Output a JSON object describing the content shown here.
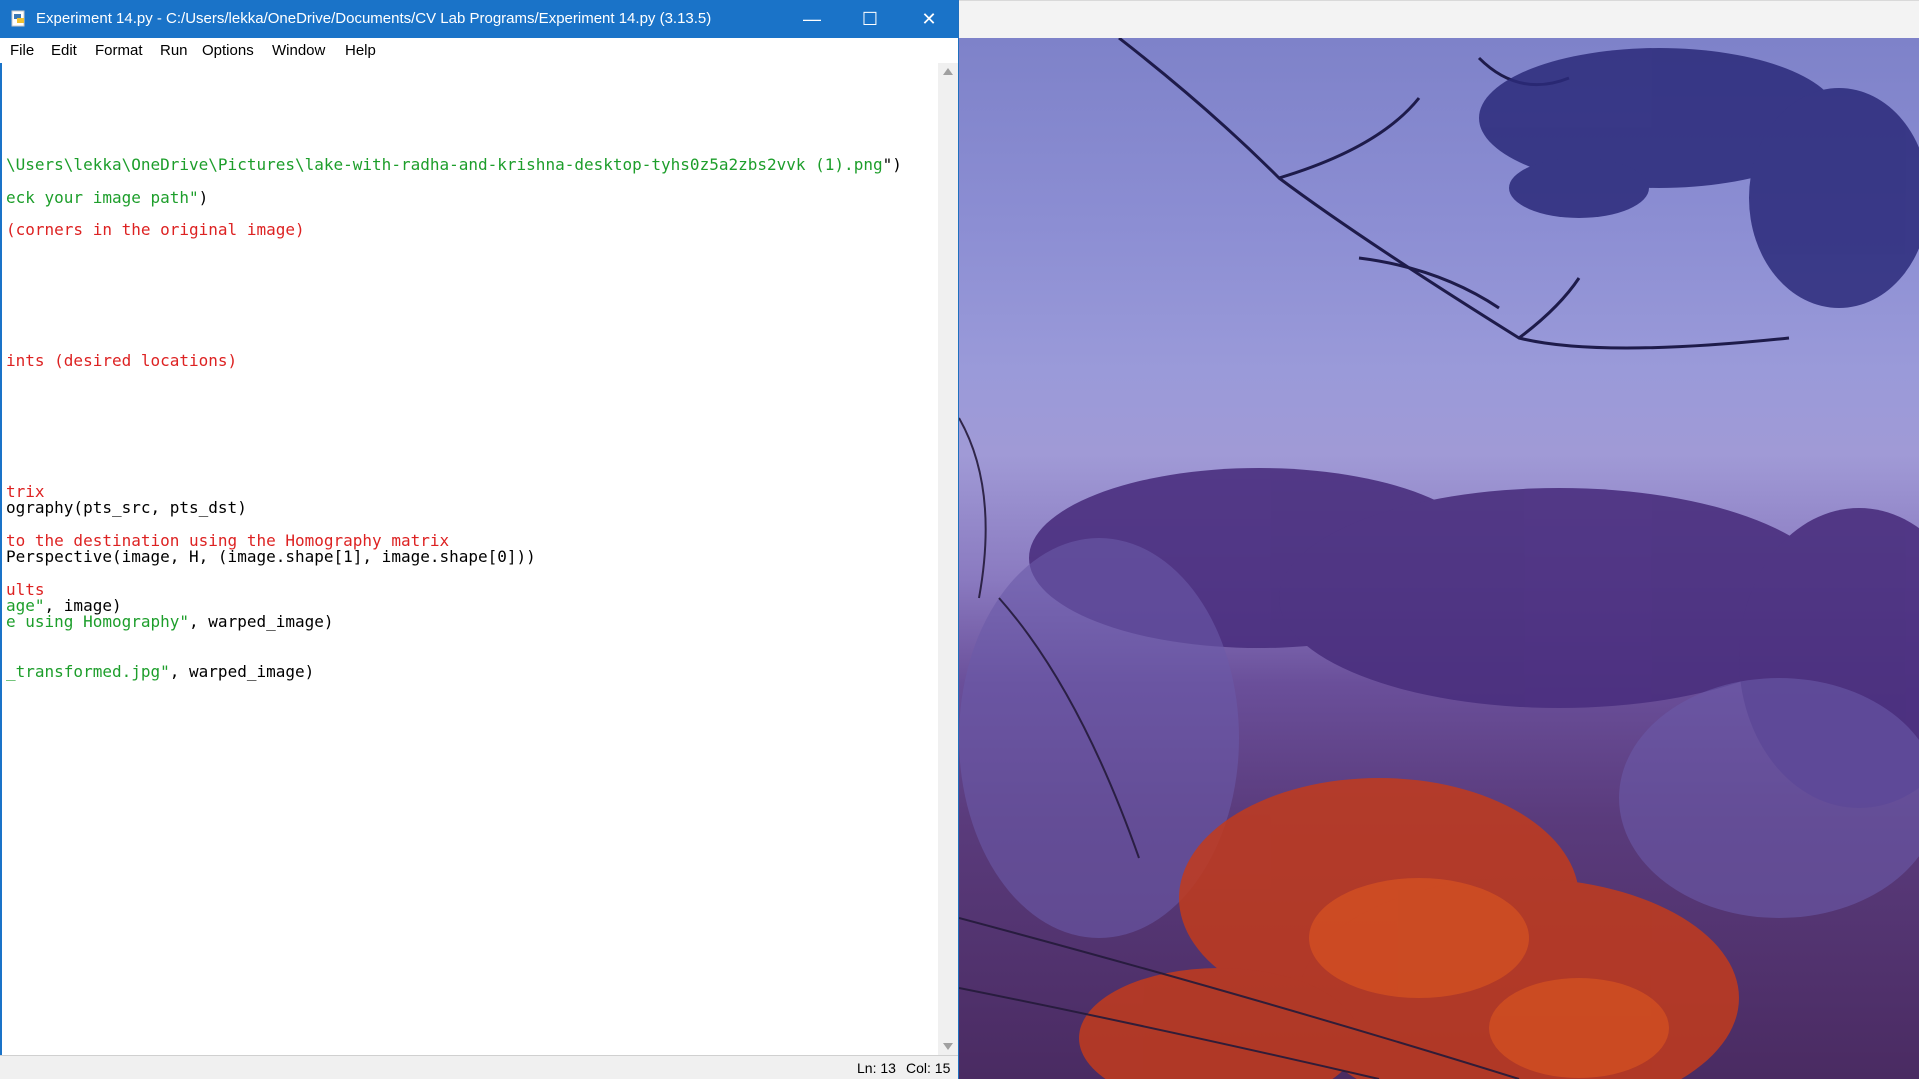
{
  "window": {
    "title": "Experiment 14.py - C:/Users/lekka/OneDrive/Documents/CV Lab Programs/Experiment 14.py (3.13.5)",
    "minimize_glyph": "—",
    "maximize_glyph": "☐",
    "close_glyph": "✕"
  },
  "menu": [
    "File",
    "Edit",
    "Format",
    "Run",
    "Options",
    "Window",
    "Help"
  ],
  "code_lines": [
    {
      "segments": [
        {
          "text": "\\Users\\lekka\\OneDrive\\Pictures\\lake-with-radha-and-krishna-desktop-tyhs0z5a2zbs2vvk (1).png",
          "cls": "str"
        },
        {
          "text": "\")",
          "cls": ""
        }
      ]
    },
    {
      "segments": [
        {
          "text": "eck your image path\"",
          "cls": "str"
        },
        {
          "text": ")",
          "cls": ""
        }
      ]
    },
    {
      "segments": [
        {
          "text": "(corners in the original image)",
          "cls": "com"
        }
      ]
    },
    {
      "segments": [
        {
          "text": "ints (desired locations)",
          "cls": "com"
        }
      ]
    },
    {
      "segments": [
        {
          "text": "trix",
          "cls": "com"
        }
      ]
    },
    {
      "segments": [
        {
          "text": "ography(pts_src, pts_dst)",
          "cls": ""
        }
      ]
    },
    {
      "segments": [
        {
          "text": "to the destination using the Homography matrix",
          "cls": "com"
        }
      ]
    },
    {
      "segments": [
        {
          "text": "Perspective(image, H, (image.shape[1], image.shape[0]))",
          "cls": ""
        }
      ]
    },
    {
      "segments": [
        {
          "text": "ults",
          "cls": "com"
        }
      ]
    },
    {
      "segments": [
        {
          "text": "age\"",
          "cls": "str"
        },
        {
          "text": ", image)",
          "cls": ""
        }
      ]
    },
    {
      "segments": [
        {
          "text": "e using Homography\"",
          "cls": "str"
        },
        {
          "text": ", warped_image)",
          "cls": ""
        }
      ]
    },
    {
      "segments": [
        {
          "text": "_transformed.jpg\"",
          "cls": "str"
        },
        {
          "text": ", warped_image)",
          "cls": ""
        }
      ]
    }
  ],
  "status": {
    "line": "Ln: 13",
    "col": "Col: 15"
  },
  "colors": {
    "titlebar": "#1a73c8",
    "string": "#1d9e2b",
    "comment": "#dd2222"
  },
  "icons": [
    "python-file-icon",
    "minimize-icon",
    "maximize-icon",
    "close-icon"
  ]
}
